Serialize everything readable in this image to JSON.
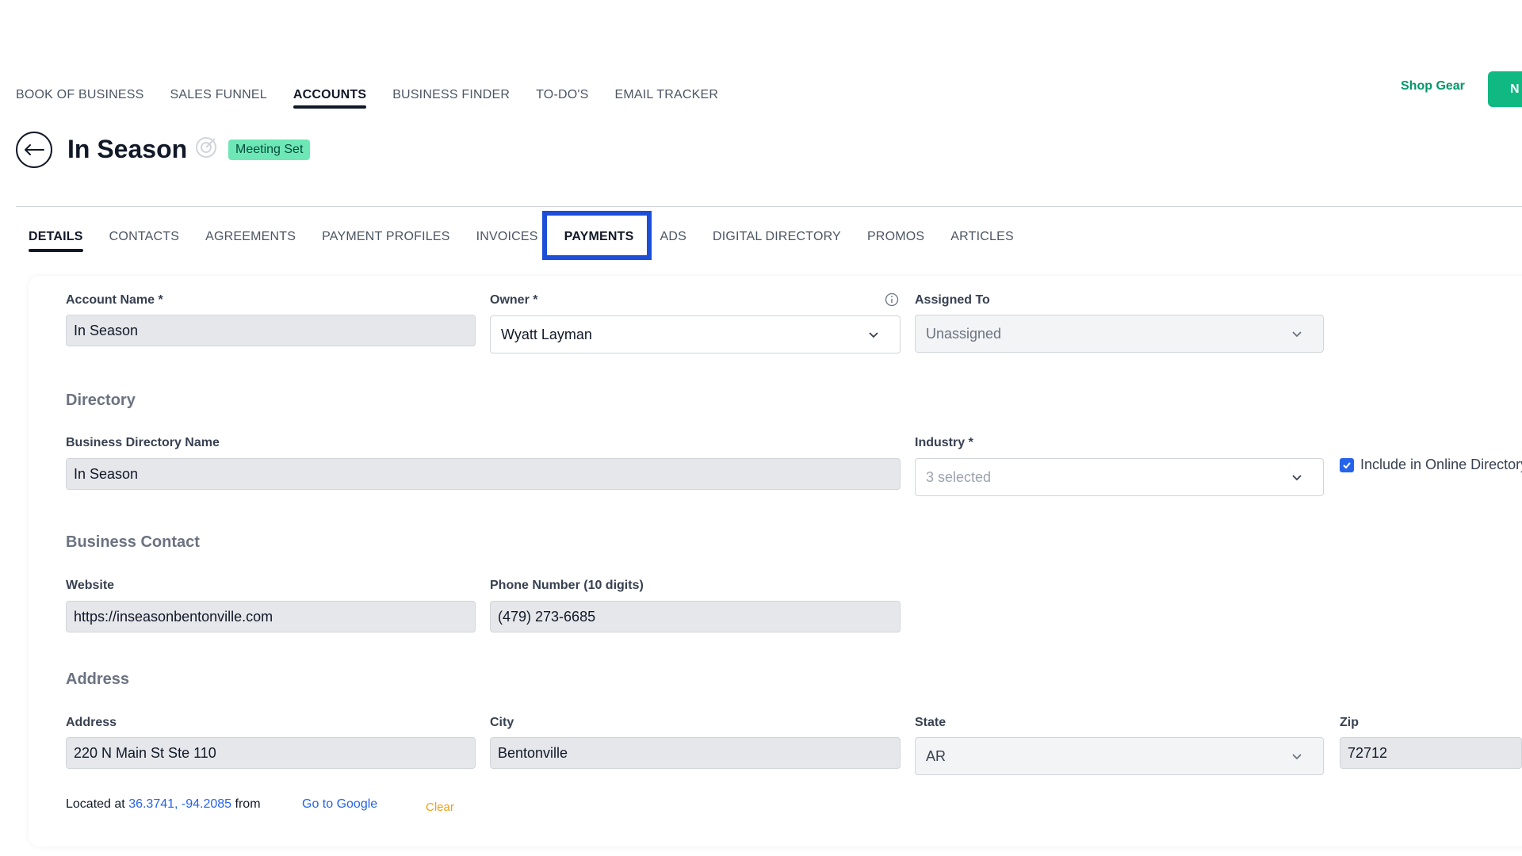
{
  "top_nav": {
    "items": [
      "BOOK OF BUSINESS",
      "SALES FUNNEL",
      "ACCOUNTS",
      "BUSINESS FINDER",
      "TO-DO'S",
      "EMAIL TRACKER"
    ],
    "shop_gear": "Shop Gear",
    "new_button": "N"
  },
  "account": {
    "name": "In Season",
    "status_badge": "Meeting Set"
  },
  "sub_tabs": [
    "DETAILS",
    "CONTACTS",
    "AGREEMENTS",
    "PAYMENT PROFILES",
    "INVOICES",
    "PAYMENTS",
    "ADS",
    "DIGITAL DIRECTORY",
    "PROMOS",
    "ARTICLES"
  ],
  "form": {
    "account_name_label": "Account Name *",
    "account_name": "In Season",
    "owner_label": "Owner *",
    "owner": "Wyatt Layman",
    "assigned_to_label": "Assigned To",
    "assigned_to": "Unassigned",
    "directory_heading": "Directory",
    "business_directory_name_label": "Business Directory Name",
    "business_directory_name": "In Season",
    "industry_label": "Industry *",
    "industry": "3 selected",
    "include_online_label": "Include in Online Directory",
    "business_contact_heading": "Business Contact",
    "website_label": "Website",
    "website": "https://inseasonbentonville.com",
    "phone_label": "Phone Number (10 digits)",
    "phone": "(479) 273-6685",
    "address_heading": "Address",
    "address_label": "Address",
    "address": "220 N Main St Ste 110",
    "city_label": "City",
    "city": "Bentonville",
    "state_label": "State",
    "state": "AR",
    "zip_label": "Zip",
    "zip": "72712",
    "located_prefix": "Located at",
    "coords": "36.3741, -94.2085",
    "located_from": "from",
    "go_to_google": "Go to Google",
    "clear": "Clear"
  },
  "colors": {
    "accent_green": "#10b981",
    "highlight_blue": "#1d4ed8",
    "badge_green": "#6ee7b7"
  }
}
